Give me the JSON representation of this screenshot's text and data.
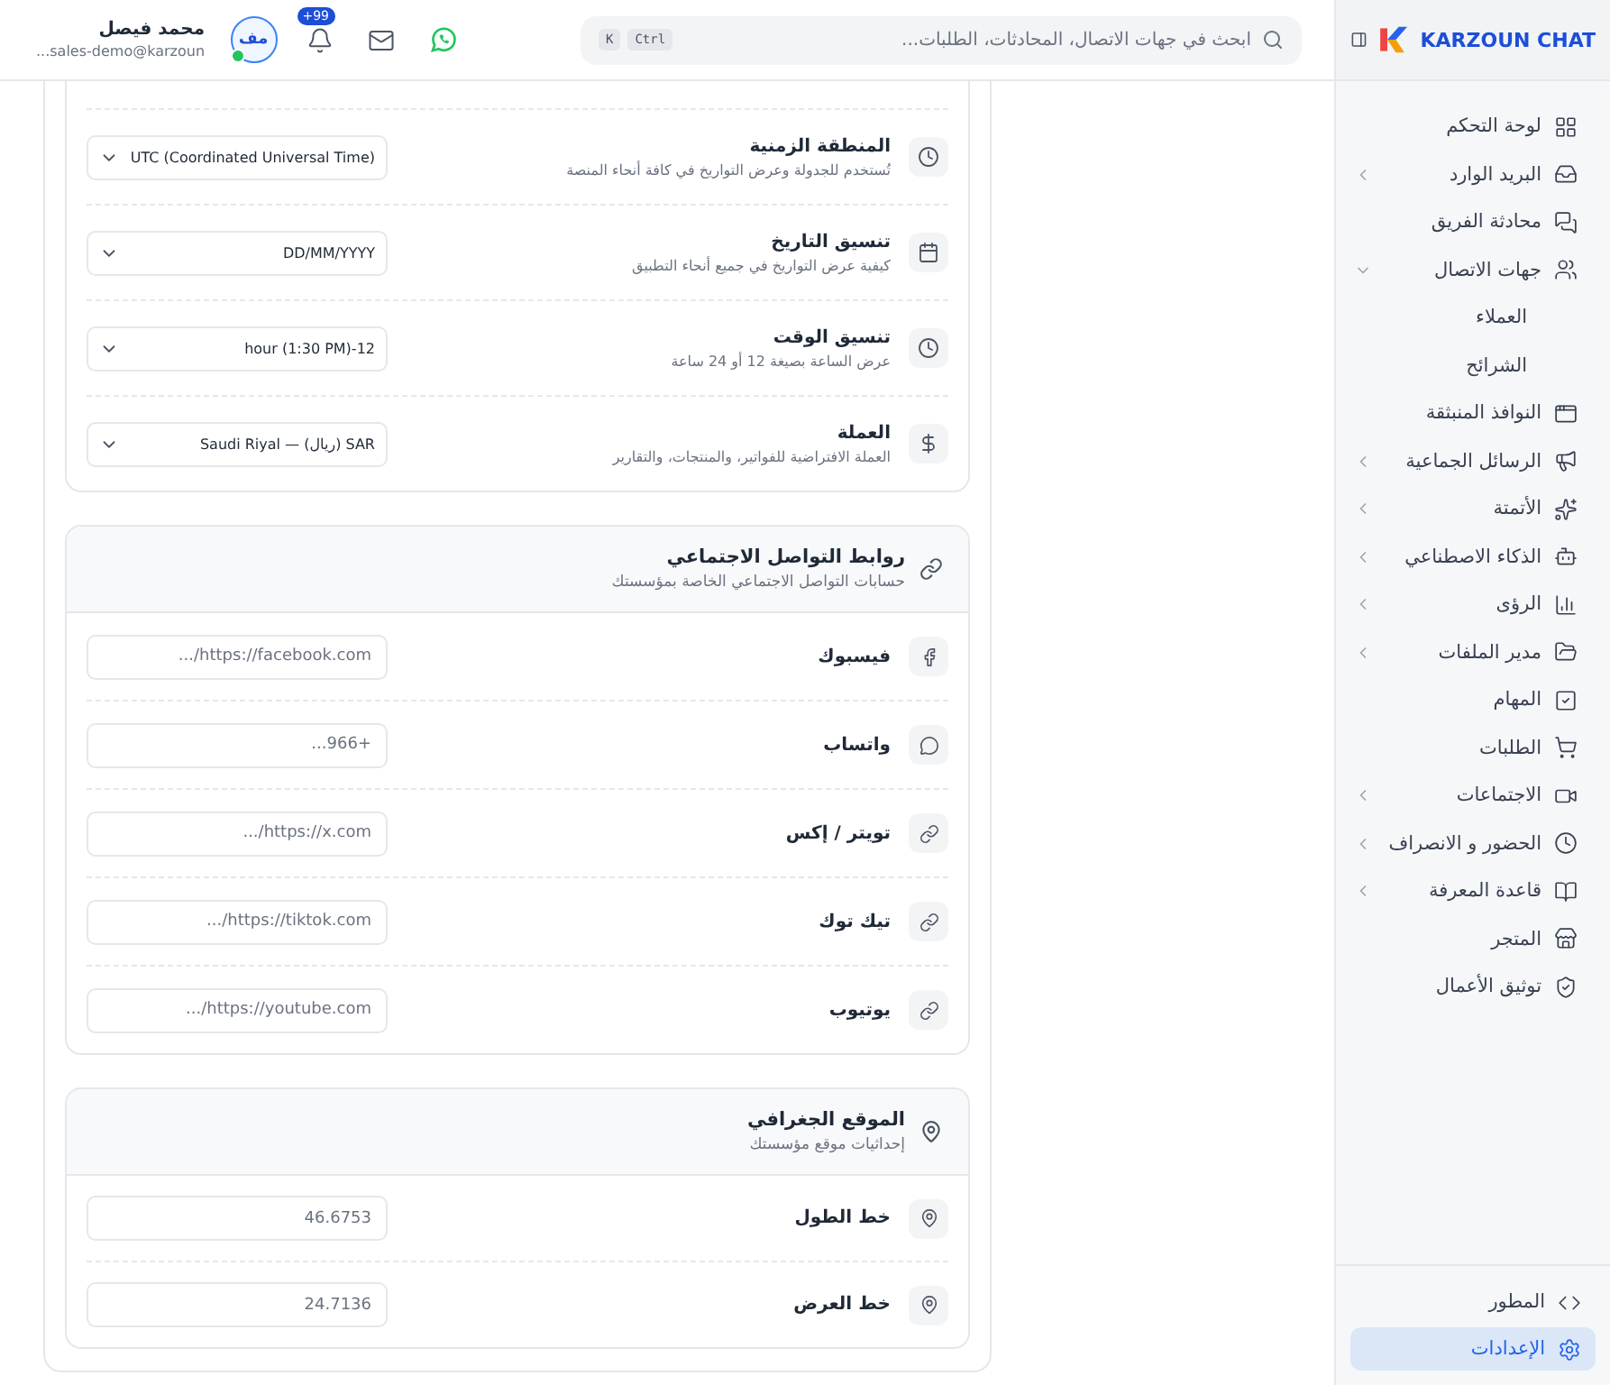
{
  "header": {
    "search": {
      "placeholder": "ابحث في جهات الاتصال، المحادثات، الطلبات...",
      "keys": [
        "Ctrl",
        "K"
      ]
    },
    "notifications_badge": "+99",
    "user": {
      "name": "محمد فيصل",
      "email": "sales-demo@karzoun...",
      "initials": "مف",
      "online": true
    }
  },
  "sidebar": {
    "brand": "KARZOUN CHAT",
    "items": [
      {
        "label": "لوحة التحكم",
        "kind": "link"
      },
      {
        "label": "البريد الوارد",
        "kind": "group",
        "expanded": false
      },
      {
        "label": "محادثة الفريق",
        "kind": "link"
      },
      {
        "label": "جهات الاتصال",
        "kind": "group",
        "expanded": true,
        "children": [
          {
            "label": "العملاء"
          },
          {
            "label": "الشرائح"
          }
        ]
      },
      {
        "label": "النوافذ المنبثقة",
        "kind": "link"
      },
      {
        "label": "الرسائل الجماعية",
        "kind": "group",
        "expanded": false
      },
      {
        "label": "الأتمتة",
        "kind": "group",
        "expanded": false
      },
      {
        "label": "الذكاء الاصطناعي",
        "kind": "group",
        "expanded": false
      },
      {
        "label": "الرؤى",
        "kind": "group",
        "expanded": false
      },
      {
        "label": "مدير الملفات",
        "kind": "group",
        "expanded": false
      },
      {
        "label": "المهام",
        "kind": "link"
      },
      {
        "label": "الطلبات",
        "kind": "link"
      },
      {
        "label": "الاجتماعات",
        "kind": "group",
        "expanded": false
      },
      {
        "label": "الحضور و الانصراف",
        "kind": "group",
        "expanded": false
      },
      {
        "label": "قاعدة المعرفة",
        "kind": "group",
        "expanded": false
      },
      {
        "label": "المتجر",
        "kind": "link"
      },
      {
        "label": "توثيق الأعمال",
        "kind": "link"
      }
    ],
    "footer_items": [
      {
        "label": "المطور",
        "selected": false
      },
      {
        "label": "الإعدادات",
        "selected": true
      }
    ]
  },
  "general": {
    "rows": [
      {
        "label": "المنطقة الزمنية",
        "description": "تُستخدم للجدولة وعرض التواريخ في كافة أنحاء المنصة",
        "value": "UTC (Coordinated Universal Time)"
      },
      {
        "label": "تنسيق التاريخ",
        "description": "كيفية عرض التواريخ في جميع أنحاء التطبيق",
        "value": "DD/MM/YYYY"
      },
      {
        "label": "تنسيق الوقت",
        "description": "عرض الساعة بصيغة 12 أو 24 ساعة",
        "value": "12-hour (1:30 PM)"
      },
      {
        "label": "العملة",
        "description": "العملة الافتراضية للفواتير، والمنتجات، والتقارير",
        "value": "SAR (ريال) — Saudi Riyal"
      }
    ]
  },
  "social": {
    "title": "روابط التواصل الاجتماعي",
    "subtitle": "حسابات التواصل الاجتماعي الخاصة بمؤسستك",
    "rows": [
      {
        "label": "فيسبوك",
        "placeholder": "https://facebook.com/..."
      },
      {
        "label": "واتساب",
        "placeholder": "+966..."
      },
      {
        "label": "تويتر / إكس",
        "placeholder": "https://x.com/..."
      },
      {
        "label": "تيك توك",
        "placeholder": "https://tiktok.com/..."
      },
      {
        "label": "يوتيوب",
        "placeholder": "https://youtube.com/..."
      }
    ]
  },
  "location": {
    "title": "الموقع الجغرافي",
    "subtitle": "إحداثيات موقع مؤسستك",
    "rows": [
      {
        "label": "خط الطول",
        "placeholder": "46.6753"
      },
      {
        "label": "خط العرض",
        "placeholder": "24.7136"
      }
    ]
  }
}
